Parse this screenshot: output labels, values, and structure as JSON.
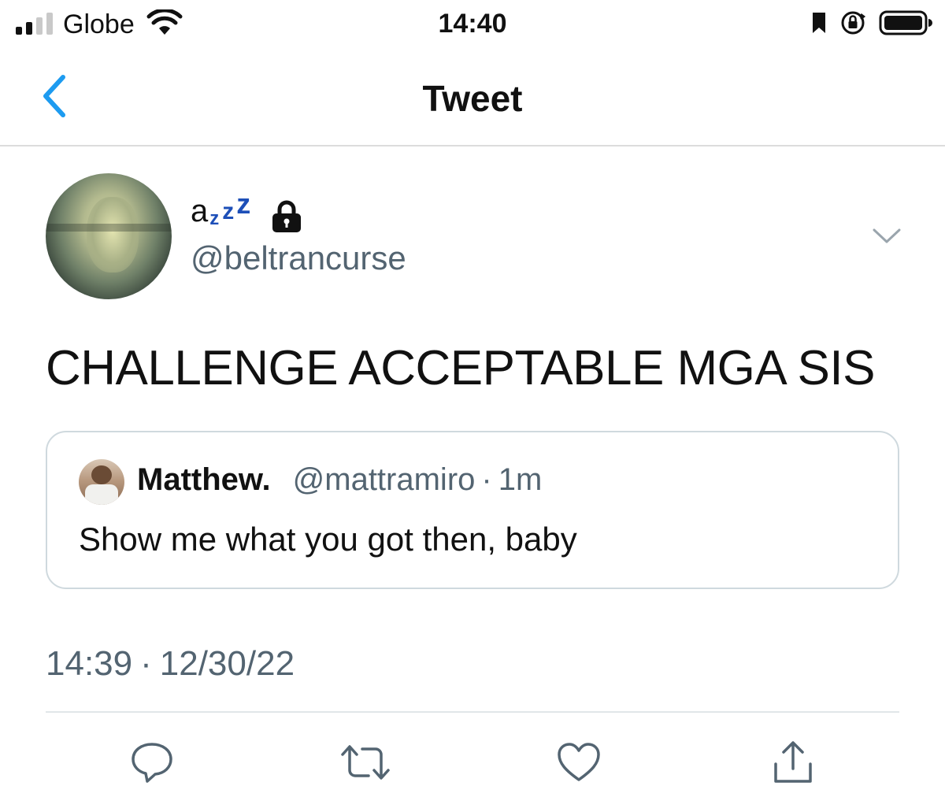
{
  "status_bar": {
    "carrier": "Globe",
    "time": "14:40",
    "signal_bars_filled": 2,
    "signal_bars_total": 4
  },
  "nav": {
    "title": "Tweet",
    "back_icon": "chevron-left-icon"
  },
  "tweet": {
    "display_name_prefix": "a",
    "display_name_emoji": "zzz",
    "protected_icon": "lock-icon",
    "username": "@beltrancurse",
    "text": "CHALLENGE ACCEPTABLE MGA SIS",
    "time": "14:39",
    "separator": "·",
    "date": "12/30/22"
  },
  "quoted_tweet": {
    "name": "Matthew.",
    "handle": "@mattramiro",
    "separator": "·",
    "age": "1m",
    "text": "Show me what you got then, baby"
  },
  "actions": {
    "reply_icon": "reply-bubble-icon",
    "retweet_icon": "retweet-icon",
    "like_icon": "heart-icon",
    "share_icon": "share-icon"
  },
  "colors": {
    "accent": "#1d9bf0",
    "secondary_text": "#536471",
    "zzz_blue": "#1d4fb8",
    "border": "#cfd9de"
  }
}
